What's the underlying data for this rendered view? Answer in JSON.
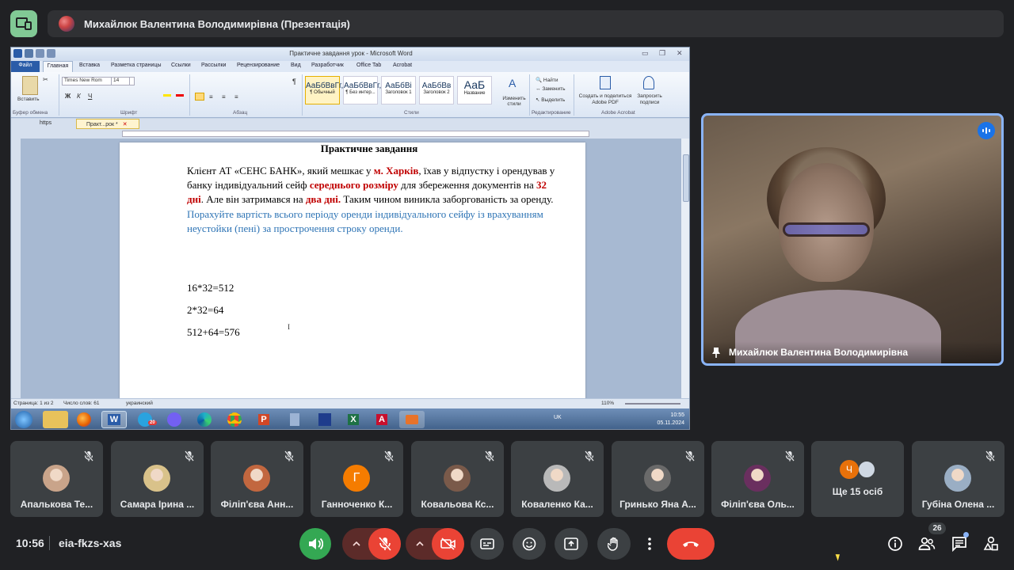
{
  "presentation": {
    "title": "Михайлюк Валентина Володимирівна (Презентація)"
  },
  "word": {
    "window_title": "Практичне завдання урок - Microsoft Word",
    "ribbon_tabs": [
      "Файл",
      "Главная",
      "Вставка",
      "Разметка страницы",
      "Ссылки",
      "Рассылки",
      "Рецензирование",
      "Вид",
      "Разработчик",
      "Office Tab",
      "Acrobat"
    ],
    "font_name": "Times New Rom",
    "font_size": "14",
    "paste_label": "Вставить",
    "styles": [
      {
        "sample": "АаБбВвГг,",
        "name": "¶ Обычный"
      },
      {
        "sample": "АаБбВвГг,",
        "name": "¶ Без интер..."
      },
      {
        "sample": "АаБбВі",
        "name": "Заголовок 1"
      },
      {
        "sample": "АаБбВв",
        "name": "Заголовок 2"
      },
      {
        "sample": "АаБ",
        "name": "Название"
      }
    ],
    "change_styles": "Изменить стили",
    "find": "Найти",
    "replace": "Заменить",
    "select": "Выделить",
    "create_pdf": "Создать и поделиться Adobe PDF",
    "request_signatures": "Запросить подписи",
    "group_labels": {
      "clipboard": "Буфер обмена",
      "font": "Шрифт",
      "paragraph": "Абзац",
      "styles": "Стили",
      "editing": "Редактирование",
      "acrobat": "Adobe Acrobat"
    },
    "doc_tabs": [
      "https",
      "Практ...рок *"
    ],
    "document": {
      "heading": "Практичне завдання",
      "p1_a": "Клієнт АТ «СЕНС БАНК», який мешкає у ",
      "p1_city": "м. Харків",
      "p1_b": ", їхав у відпустку і орендував у банку індивідуальний сейф ",
      "p1_size": "середнього розміру",
      "p1_c": " для збереження документів на ",
      "p1_days": "32 дні",
      "p1_d": ". Але він затримався на ",
      "p1_delay": "два дні.",
      "p1_e": " Таким чином виникла заборгованість за оренду. ",
      "p1_task": "Порахуйте вартість всього періоду оренди індивідуального сейфу із врахуванням неустойки (пені) за прострочення строку оренди.",
      "eq1": "16*32=512",
      "eq2": "2*32=64",
      "eq3": "512+64=576"
    },
    "status": {
      "page": "Страница: 1 из 2",
      "words": "Число слов: 61",
      "language": "украинский",
      "zoom": "110%"
    },
    "taskbar": {
      "lang": "UK",
      "time": "10:55",
      "date": "05.11.2024",
      "telegram_badge": "20"
    }
  },
  "speaker": {
    "name": "Михайлюк Валентина Володимирівна"
  },
  "participants": [
    {
      "name": "Апалькова Те...",
      "color": "#c9a48a"
    },
    {
      "name": "Самара Ірина ...",
      "color": "#d9c28a"
    },
    {
      "name": "Філіп'єва Анн...",
      "color": "#c2673f"
    },
    {
      "name": "Ганноченко К...",
      "letter": "Г",
      "color": "#f57c00"
    },
    {
      "name": "Ковальова Кс...",
      "color": "#7a5a4a"
    },
    {
      "name": "Коваленко Ка...",
      "color": "#b9b9b9"
    },
    {
      "name": "Гринько Яна А...",
      "color": "#6a6a6a"
    },
    {
      "name": "Філіп'єва Оль...",
      "color": "#6a2f5f"
    },
    {
      "name": "Ще 15 осіб",
      "letter": "Ч",
      "color": "#e8710a"
    },
    {
      "name": "Губіна Олена ...",
      "color": "#9aaec4"
    }
  ],
  "meeting": {
    "time": "10:56",
    "code": "eia-fkzs-xas",
    "people_count": "26"
  },
  "colors": {
    "accent_red": "#ea4335",
    "accent_green": "#34a853",
    "tile_bg": "#3c4043",
    "speaker_border": "#8ab4f8"
  }
}
